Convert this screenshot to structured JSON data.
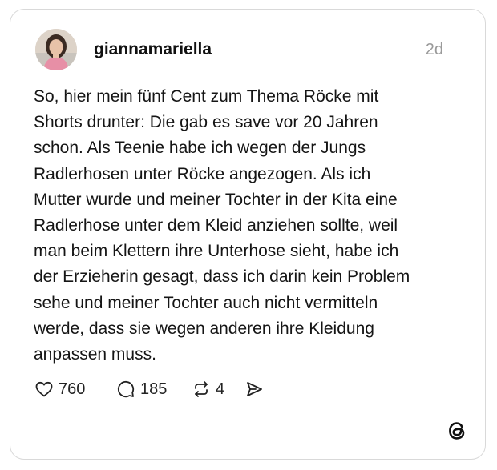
{
  "post": {
    "username": "giannamariella",
    "timestamp": "2d",
    "text": "So, hier mein fünf Cent zum Thema Röcke mit\nShorts drunter: Die gab es save vor 20 Jahren\nschon. Als Teenie habe ich wegen der Jungs\nRadlerhosen unter Röcke angezogen. Als ich\nMutter wurde und meiner Tochter in der Kita eine\nRadlerhose unter dem Kleid anziehen sollte, weil\nman beim Klettern ihre Unterhose sieht, habe ich\nder Erzieherin gesagt, dass ich darin kein Problem\nsehe und meiner Tochter auch nicht vermitteln\nwerde, dass sie wegen anderen ihre Kleidung\nanpassen muss."
  },
  "actions": {
    "likes": {
      "icon": "heart-icon",
      "count": "760"
    },
    "replies": {
      "icon": "comment-icon",
      "count": "185"
    },
    "reposts": {
      "icon": "repost-icon",
      "count": "4"
    },
    "share": {
      "icon": "send-icon"
    }
  },
  "branding": {
    "icon": "threads-logo-icon"
  },
  "colors": {
    "border": "#d9d9d9",
    "timestamp": "#9a9a9a",
    "text": "#151515"
  }
}
